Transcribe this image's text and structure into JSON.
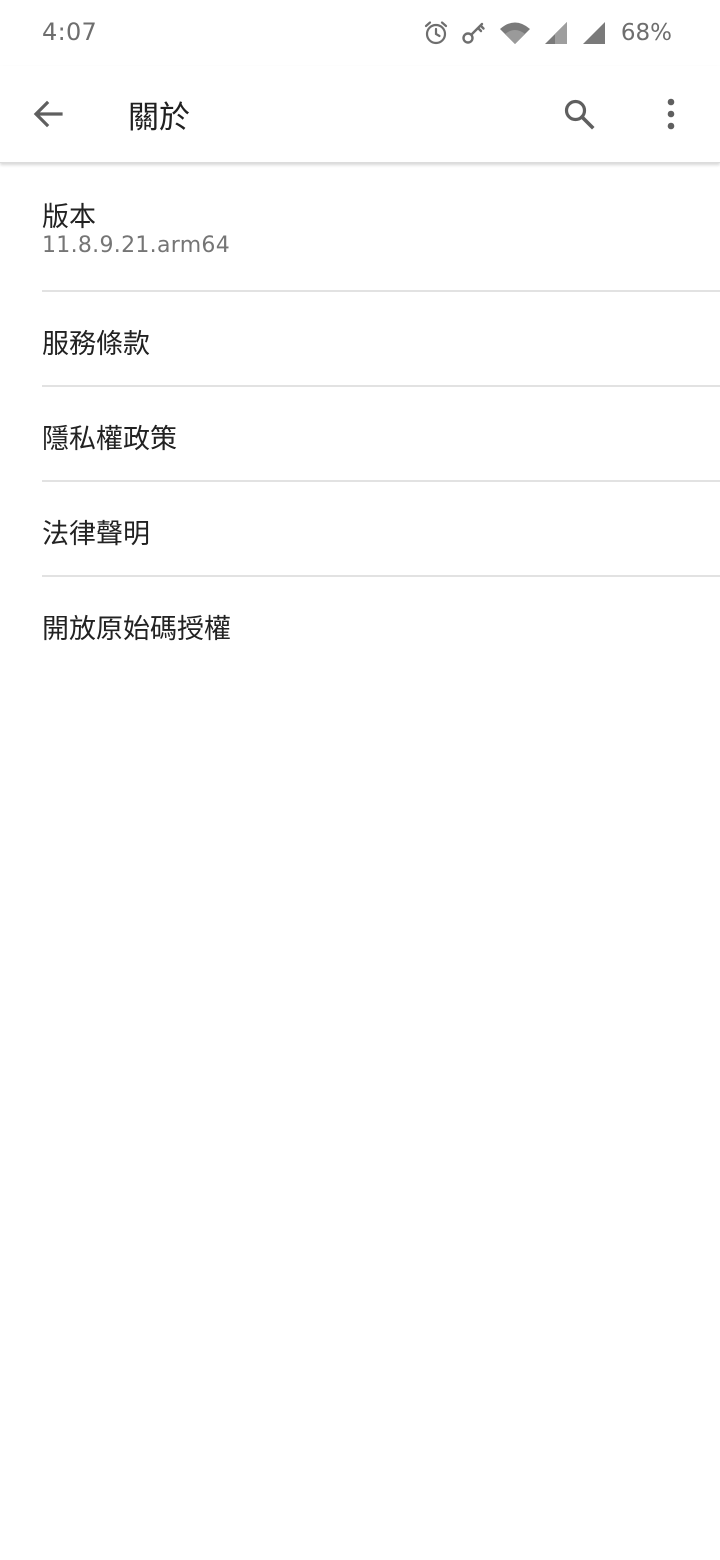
{
  "status_bar": {
    "time": "4:07",
    "battery": "68%",
    "icons": [
      "alarm-icon",
      "vpn-key-icon",
      "wifi-icon",
      "cell-signal-icon",
      "cell-signal-icon"
    ]
  },
  "app_bar": {
    "title": "關於",
    "icons": [
      "back-arrow-icon",
      "search-icon",
      "more-vert-icon"
    ]
  },
  "items": [
    {
      "title": "版本",
      "summary": "11.8.9.21.arm64"
    },
    {
      "title": "服務條款"
    },
    {
      "title": "隱私權政策"
    },
    {
      "title": "法律聲明"
    },
    {
      "title": "開放原始碼授權"
    }
  ],
  "colors": {
    "background": "#ffffff",
    "icon": "#5f5f5f",
    "title_text": "#222222",
    "summary_text": "#757575",
    "divider": "#e2e2e2"
  }
}
